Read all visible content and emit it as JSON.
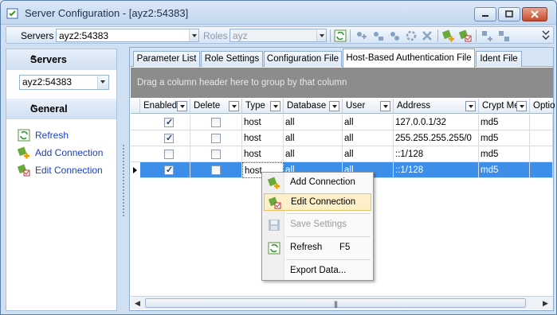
{
  "window": {
    "title": "Server Configuration - [ayz2:54383]"
  },
  "toolbar": {
    "servers_label": "Servers",
    "servers_value": "ayz2:54383",
    "roles_label": "Roles",
    "roles_value": "ayz"
  },
  "sidebar": {
    "servers_header": "Servers",
    "server_select": "ayz2:54383",
    "general_header": "General",
    "links": [
      "Refresh",
      "Add Connection",
      "Edit Connection"
    ]
  },
  "tabs": [
    "Parameter List",
    "Role Settings",
    "Configuration File",
    "Host-Based Authentication File",
    "Ident File"
  ],
  "active_tab": 3,
  "group_hint": "Drag a column header here to group by that column",
  "grid": {
    "columns": [
      "Enabled",
      "Delete",
      "Type",
      "Database",
      "User",
      "Address",
      "Crypt Me",
      "Optio"
    ],
    "rows": [
      {
        "enabled": true,
        "delete": false,
        "type": "host",
        "database": "all",
        "user": "all",
        "address": "127.0.0.1/32",
        "method": "md5"
      },
      {
        "enabled": true,
        "delete": false,
        "type": "host",
        "database": "all",
        "user": "all",
        "address": "255.255.255.255/0",
        "method": "md5"
      },
      {
        "enabled": false,
        "delete": false,
        "type": "host",
        "database": "all",
        "user": "all",
        "address": "::1/128",
        "method": "md5"
      },
      {
        "enabled": true,
        "delete": false,
        "type": "host",
        "database": "all",
        "user": "all",
        "address": "::1/128",
        "method": "md5"
      }
    ],
    "selected_row": 3
  },
  "context_menu": {
    "items": [
      {
        "label": "Add Connection",
        "shortcut": "",
        "state": "normal"
      },
      {
        "label": "Edit Connection",
        "shortcut": "",
        "state": "highlighted"
      },
      {
        "label": "Save Settings",
        "shortcut": "",
        "state": "disabled"
      },
      {
        "label": "Refresh",
        "shortcut": "F5",
        "state": "normal"
      },
      {
        "label": "Export Data...",
        "shortcut": "",
        "state": "normal"
      }
    ]
  },
  "colors": {
    "selection": "#3d8ee8",
    "link": "#1a3fbf",
    "menu_highlight": "#fdefc8"
  },
  "icons": [
    "server-config-icon",
    "minimize-icon",
    "maximize-icon",
    "close-icon",
    "refresh-icon",
    "add-connection-icon",
    "edit-connection-icon",
    "save-icon",
    "delete-icon"
  ]
}
